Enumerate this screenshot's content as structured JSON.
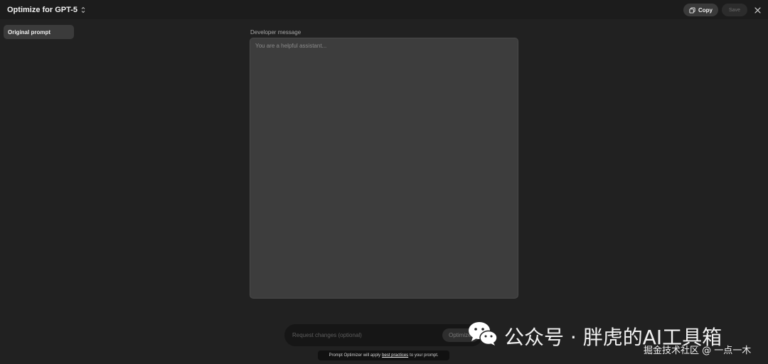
{
  "header": {
    "title": "Optimize for GPT-5",
    "title_icon": "chevron-updown-icon",
    "copy_label": "Copy",
    "copy_icon": "copy-icon",
    "save_label": "Save",
    "close_icon": "close-icon"
  },
  "sidebar": {
    "items": [
      {
        "label": "Original prompt",
        "active": true
      }
    ]
  },
  "editor": {
    "label": "Developer message",
    "value": "",
    "placeholder": "You are a helpful assistant..."
  },
  "request": {
    "value": "",
    "placeholder": "Request changes (optional)",
    "optimize_label": "Optimize"
  },
  "hint": {
    "prefix": "Prompt Optimizer will apply",
    "link": "best practices",
    "suffix": "to your prompt."
  },
  "watermark": {
    "icon": "wechat-icon",
    "title": "公众号 · 胖虎的AI工具箱",
    "subtitle": "掘金技术社区 @ 一点一木"
  },
  "colors": {
    "background": "#212121",
    "topbar": "#1c1c1c",
    "sidebar_active": "#3b3b3b",
    "textarea": "#3d3d3d",
    "request_bar": "#161616"
  }
}
